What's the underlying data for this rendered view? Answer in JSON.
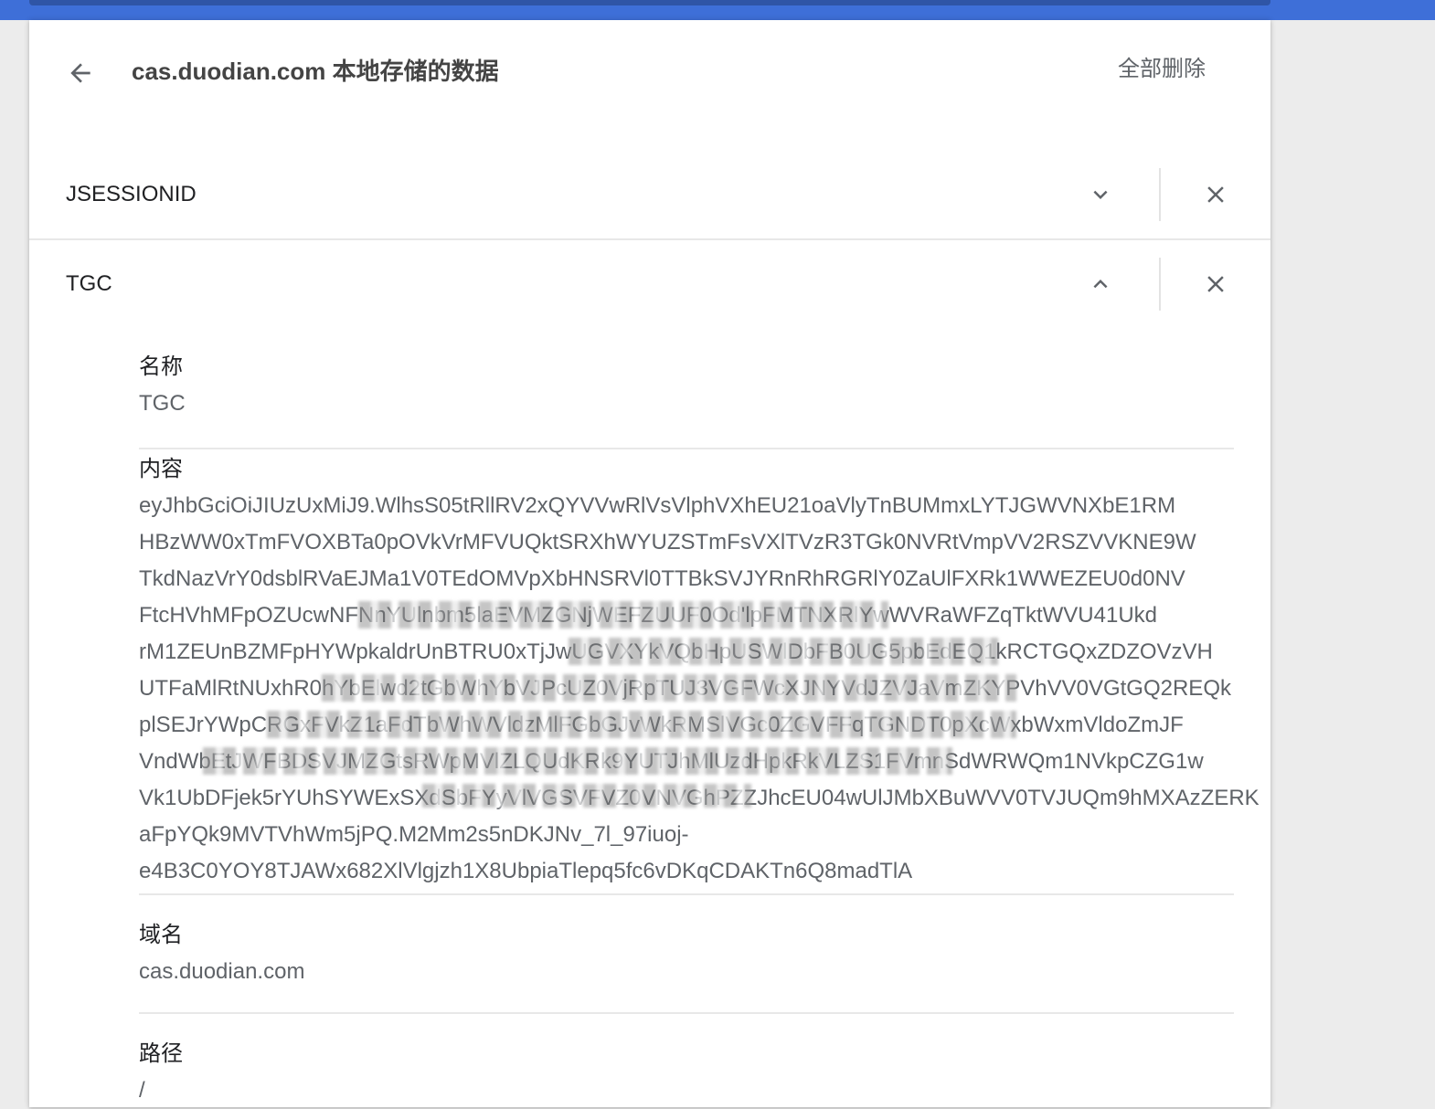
{
  "header": {
    "title": "cas.duodian.com 本地存储的数据",
    "remove_all_label": "全部删除",
    "back_icon": "arrow-back-icon"
  },
  "cookies": [
    {
      "name": "JSESSIONID",
      "expanded": false,
      "expand_icon": "chevron-down-icon",
      "remove_icon": "close-icon"
    },
    {
      "name": "TGC",
      "expanded": true,
      "expand_icon": "chevron-up-icon",
      "remove_icon": "close-icon"
    }
  ],
  "details": {
    "name": {
      "label": "名称",
      "value": "TGC"
    },
    "content": {
      "label": "内容",
      "lines": [
        "eyJhbGciOiJIUzUxMiJ9.WlhsS05tRllRV2xQYVVwRlVsVlphVXhEU21oaVlyTnBUMmxLYTJGWVNXbE1RM",
        "HBzWW0xTmFVOXBTa0pOVkVrMFVUQktSRXhWYUZSTmFsVXlTVzR3TGk0NVRtVmpVV2RSZVVKNE9W",
        "TkdNazVrY0dsblRVaEJMa1V0TEdOMVpXbHNSRVl0TTBkSVJYRnRhRGRlY0ZaUlFXRk1WWEZEU0d0NV",
        "FtcHVhMFpOZUcwNFNnYUlnbm5laEVMZGNjWEFZUUF0Od'lpFMTNXRlYwWVRaWFZqTktWVU41Ukd",
        "rM1ZEUnBZMFpHYWpkaldrUnBTRU0xTjJwUGVXYkVQbHpUSWlDbFB0UG5pbEdEQ1kRCTGQxZDZOVzVH",
        "UTFaMlRtNUxhR0hYbElwd2tGbWhYbVJPcUZ0VjRpTUJ3VGFWcXJNYVdJZVJaVmZKYPVhVV0VGtGQ2REQk",
        "plSEJrYWpCRGxFVkZ1aFdTbWhWVldzMlFGbGJvWkRMSlVGc0ZGVFFqTGNDT0pXcWxbWxmVldoZmJF",
        "VndWbEtJWFBDSVJMZGtsRWpMVlZLQUdKRk9YUTJhMlUzdHpkRkVLZS1FVmnSdWRWQm1NVkpCZG1w",
        "Vk1UbDFjek5rYUhSYWExSXdSbFYyVlVGSVFVZ0VNVGhPZZJhcEU04wUlJMbXBuWVV0TVJUQm9hMXAzZERK",
        "aFpYQk9MVTVhWm5jPQ.M2Mm2s5nDKJNv_7l_97iuoj-",
        "e4B3C0YOY8TJAWx682XlVlgjzh1X8UbpiaTlepq5fc6vDKqCDAKTn6Q8madTlA"
      ]
    },
    "domain": {
      "label": "域名",
      "value": "cas.duodian.com"
    },
    "path": {
      "label": "路径",
      "value": "/"
    }
  },
  "colors": {
    "top_bar": "#3e6fd8",
    "text_primary": "#202124",
    "text_secondary": "#5f6368"
  }
}
